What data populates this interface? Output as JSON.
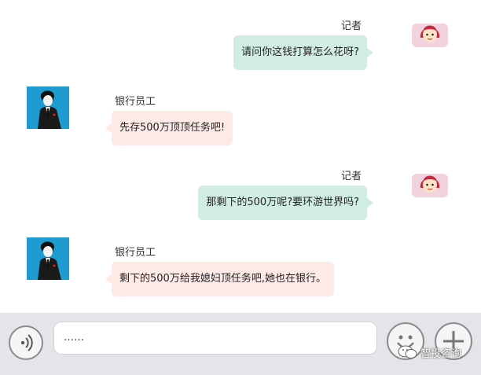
{
  "messages": [
    {
      "sender": "记者",
      "text": "请问你这钱打算怎么花呀?",
      "side": "right",
      "avatar": "girl-avatar-icon"
    },
    {
      "sender": "银行员工",
      "text": "先存500万顶顶任务吧!",
      "side": "left",
      "avatar": "man-in-suit-avatar-icon"
    },
    {
      "sender": "记者",
      "text": "那剩下的500万呢?要环游世界吗?",
      "side": "right",
      "avatar": "girl-avatar-icon"
    },
    {
      "sender": "银行员工",
      "text": "剩下的500万给我媳妇顶任务吧,她也在银行。",
      "side": "left",
      "avatar": "man-in-suit-avatar-icon"
    }
  ],
  "input_bar": {
    "value": "……",
    "voice_icon": "voice-icon",
    "emoji_icon": "emoji-icon",
    "add_icon": "plus-icon"
  },
  "watermark": {
    "text": "智投咨询",
    "icon": "wechat-icon"
  },
  "colors": {
    "outgoing_bubble": "#d1ece3",
    "incoming_bubble": "#fde9e6",
    "input_bar_bg": "#e5e4ea",
    "avatar_bg_man": "#1e9bd1",
    "avatar_bg_girl": "#f2d3dd"
  }
}
